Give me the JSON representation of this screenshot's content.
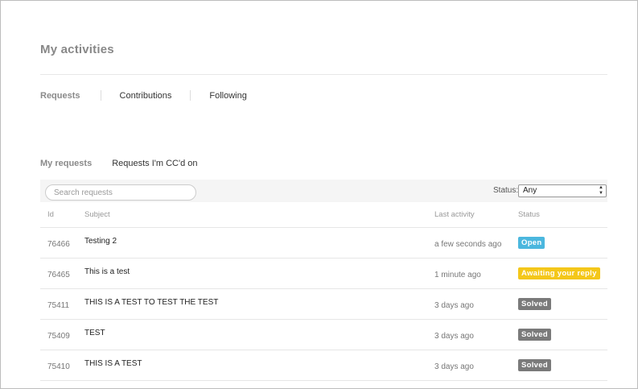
{
  "page": {
    "title": "My activities"
  },
  "main_tabs": [
    {
      "label": "Requests",
      "active": true
    },
    {
      "label": "Contributions",
      "active": false
    },
    {
      "label": "Following",
      "active": false
    }
  ],
  "sub_tabs": [
    {
      "label": "My requests",
      "active": true
    },
    {
      "label": "Requests I'm CC'd on",
      "active": false
    }
  ],
  "filters": {
    "search_placeholder": "Search requests",
    "search_value": "",
    "status_label": "Status:",
    "status_value": "Any"
  },
  "table": {
    "headers": {
      "id": "Id",
      "subject": "Subject",
      "last_activity": "Last activity",
      "status": "Status"
    },
    "rows": [
      {
        "id": "76466",
        "subject": "Testing 2",
        "last_activity": "a few seconds ago",
        "status": "Open",
        "status_color": "#4bb7de"
      },
      {
        "id": "76465",
        "subject": "This is a test",
        "last_activity": "1 minute ago",
        "status": "Awaiting your reply",
        "status_color": "#f4c71a"
      },
      {
        "id": "75411",
        "subject": "THIS IS A TEST TO TEST THE TEST",
        "last_activity": "3 days ago",
        "status": "Solved",
        "status_color": "#7a7a7a"
      },
      {
        "id": "75409",
        "subject": "TEST",
        "last_activity": "3 days ago",
        "status": "Solved",
        "status_color": "#7a7a7a"
      },
      {
        "id": "75410",
        "subject": "THIS IS A TEST",
        "last_activity": "3 days ago",
        "status": "Solved",
        "status_color": "#7a7a7a"
      }
    ]
  }
}
